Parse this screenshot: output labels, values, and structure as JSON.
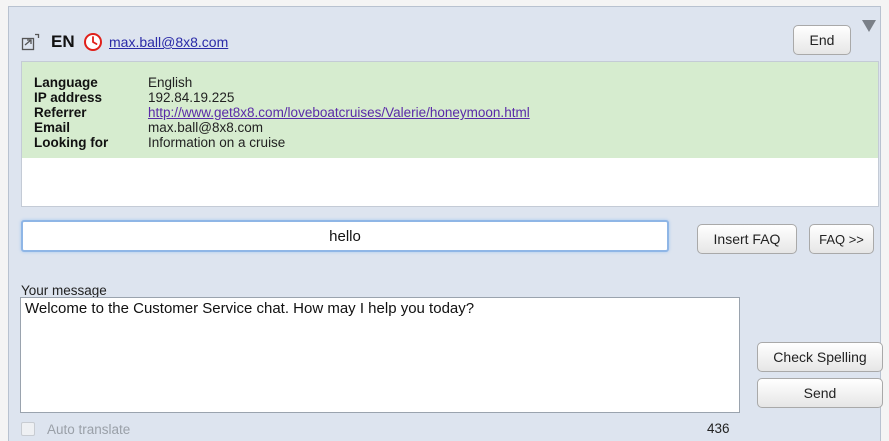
{
  "header": {
    "language_code": "EN",
    "visitor_email": "max.ball@8x8.com",
    "end_label": "End"
  },
  "info": {
    "rows": [
      {
        "label": "Language",
        "value": "English"
      },
      {
        "label": "IP address",
        "value": "192.84.19.225"
      },
      {
        "label": "Referrer",
        "value": "http://www.get8x8.com/loveboatcruises/Valerie/honeymoon.html"
      },
      {
        "label": "Email",
        "value": "max.ball@8x8.com"
      },
      {
        "label": "Looking for",
        "value": "Information on a cruise"
      }
    ]
  },
  "faq": {
    "search_value": "hello",
    "insert_label": "Insert FAQ",
    "more_label": "FAQ >>"
  },
  "message": {
    "label": "Your message",
    "text": "Welcome to the Customer Service chat. How may I help you today?",
    "check_spelling_label": "Check Spelling",
    "send_label": "Send",
    "auto_translate_label": "Auto translate",
    "auto_translate_checked": false,
    "char_count": "436"
  },
  "colors": {
    "panel_bg": "#dde4ef",
    "info_green": "#d6eccf",
    "link": "#2a2aa8",
    "input_focus": "#8fb6e6",
    "clock_red": "#e0201a"
  },
  "icons": {
    "popout": "popout-icon",
    "clock": "clock-icon",
    "dropdown": "dropdown-triangle-icon"
  }
}
